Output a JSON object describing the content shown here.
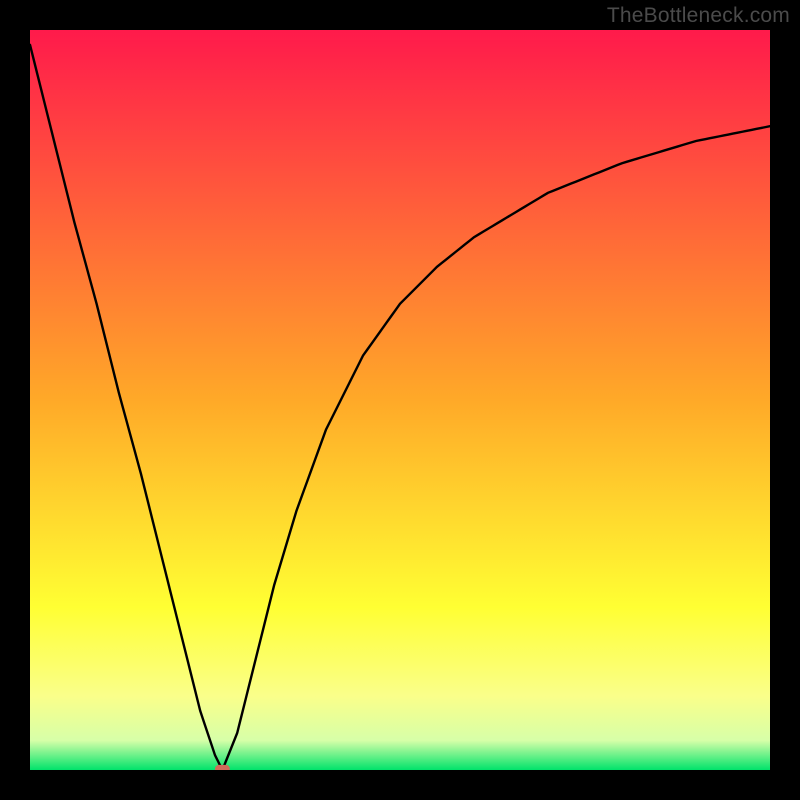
{
  "watermark": "TheBottleneck.com",
  "chart_data": {
    "type": "line",
    "title": "",
    "xlabel": "",
    "ylabel": "",
    "xlim": [
      0,
      100
    ],
    "ylim": [
      0,
      100
    ],
    "grid": false,
    "legend": false,
    "background_gradient": {
      "stops": [
        {
          "offset": 0.0,
          "color": "#ff1a4b"
        },
        {
          "offset": 0.5,
          "color": "#ffa928"
        },
        {
          "offset": 0.78,
          "color": "#ffff33"
        },
        {
          "offset": 0.9,
          "color": "#faff8a"
        },
        {
          "offset": 0.96,
          "color": "#d7ffa8"
        },
        {
          "offset": 1.0,
          "color": "#00e36b"
        }
      ]
    },
    "series": [
      {
        "name": "left-branch",
        "type": "line",
        "color": "#000000",
        "x": [
          0,
          3,
          6,
          9,
          12,
          15,
          18,
          21,
          23,
          25,
          26
        ],
        "values": [
          98,
          86,
          74,
          63,
          51,
          40,
          28,
          16,
          8,
          2,
          0
        ]
      },
      {
        "name": "right-branch",
        "type": "line",
        "color": "#000000",
        "x": [
          26,
          28,
          30,
          33,
          36,
          40,
          45,
          50,
          55,
          60,
          65,
          70,
          75,
          80,
          85,
          90,
          95,
          100
        ],
        "values": [
          0,
          5,
          13,
          25,
          35,
          46,
          56,
          63,
          68,
          72,
          75,
          78,
          80,
          82,
          83.5,
          85,
          86,
          87
        ]
      }
    ],
    "marker": {
      "name": "min-point",
      "shape": "rounded-rect",
      "color": "#cf6a59",
      "x": 26,
      "y": 0,
      "width_pct": 2.0,
      "height_pct": 1.4
    }
  }
}
